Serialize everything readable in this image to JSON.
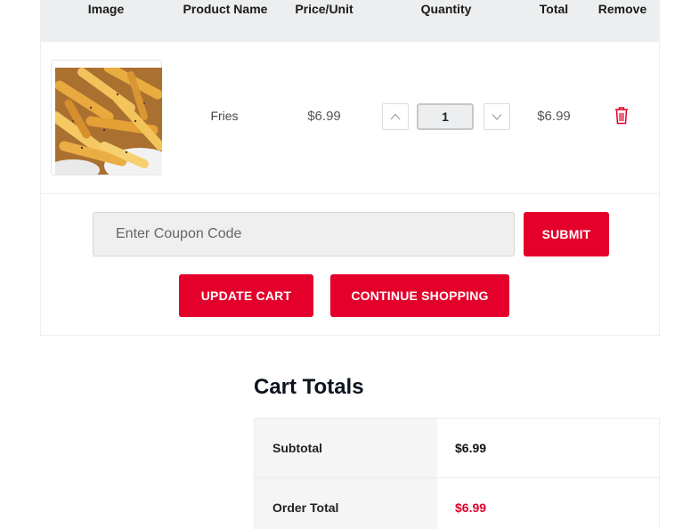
{
  "cart": {
    "headers": {
      "image": "Image",
      "product_name": "Product Name",
      "price_unit": "Price/Unit",
      "quantity": "Quantity",
      "total": "Total",
      "remove": "Remove"
    },
    "items": [
      {
        "name": "Fries",
        "price": "$6.99",
        "quantity": "1",
        "total": "$6.99",
        "image_icon": "fries-image"
      }
    ]
  },
  "coupon": {
    "placeholder": "Enter Coupon Code",
    "submit_label": "SUBMIT"
  },
  "actions": {
    "update_cart": "UPDATE CART",
    "continue_shopping": "CONTINUE SHOPPING"
  },
  "totals": {
    "title": "Cart Totals",
    "rows": [
      {
        "label": "Subtotal",
        "value": "$6.99"
      },
      {
        "label": "Order Total",
        "value": "$6.99"
      }
    ]
  },
  "colors": {
    "accent": "#e4002b",
    "header_bg": "#eceeef"
  }
}
